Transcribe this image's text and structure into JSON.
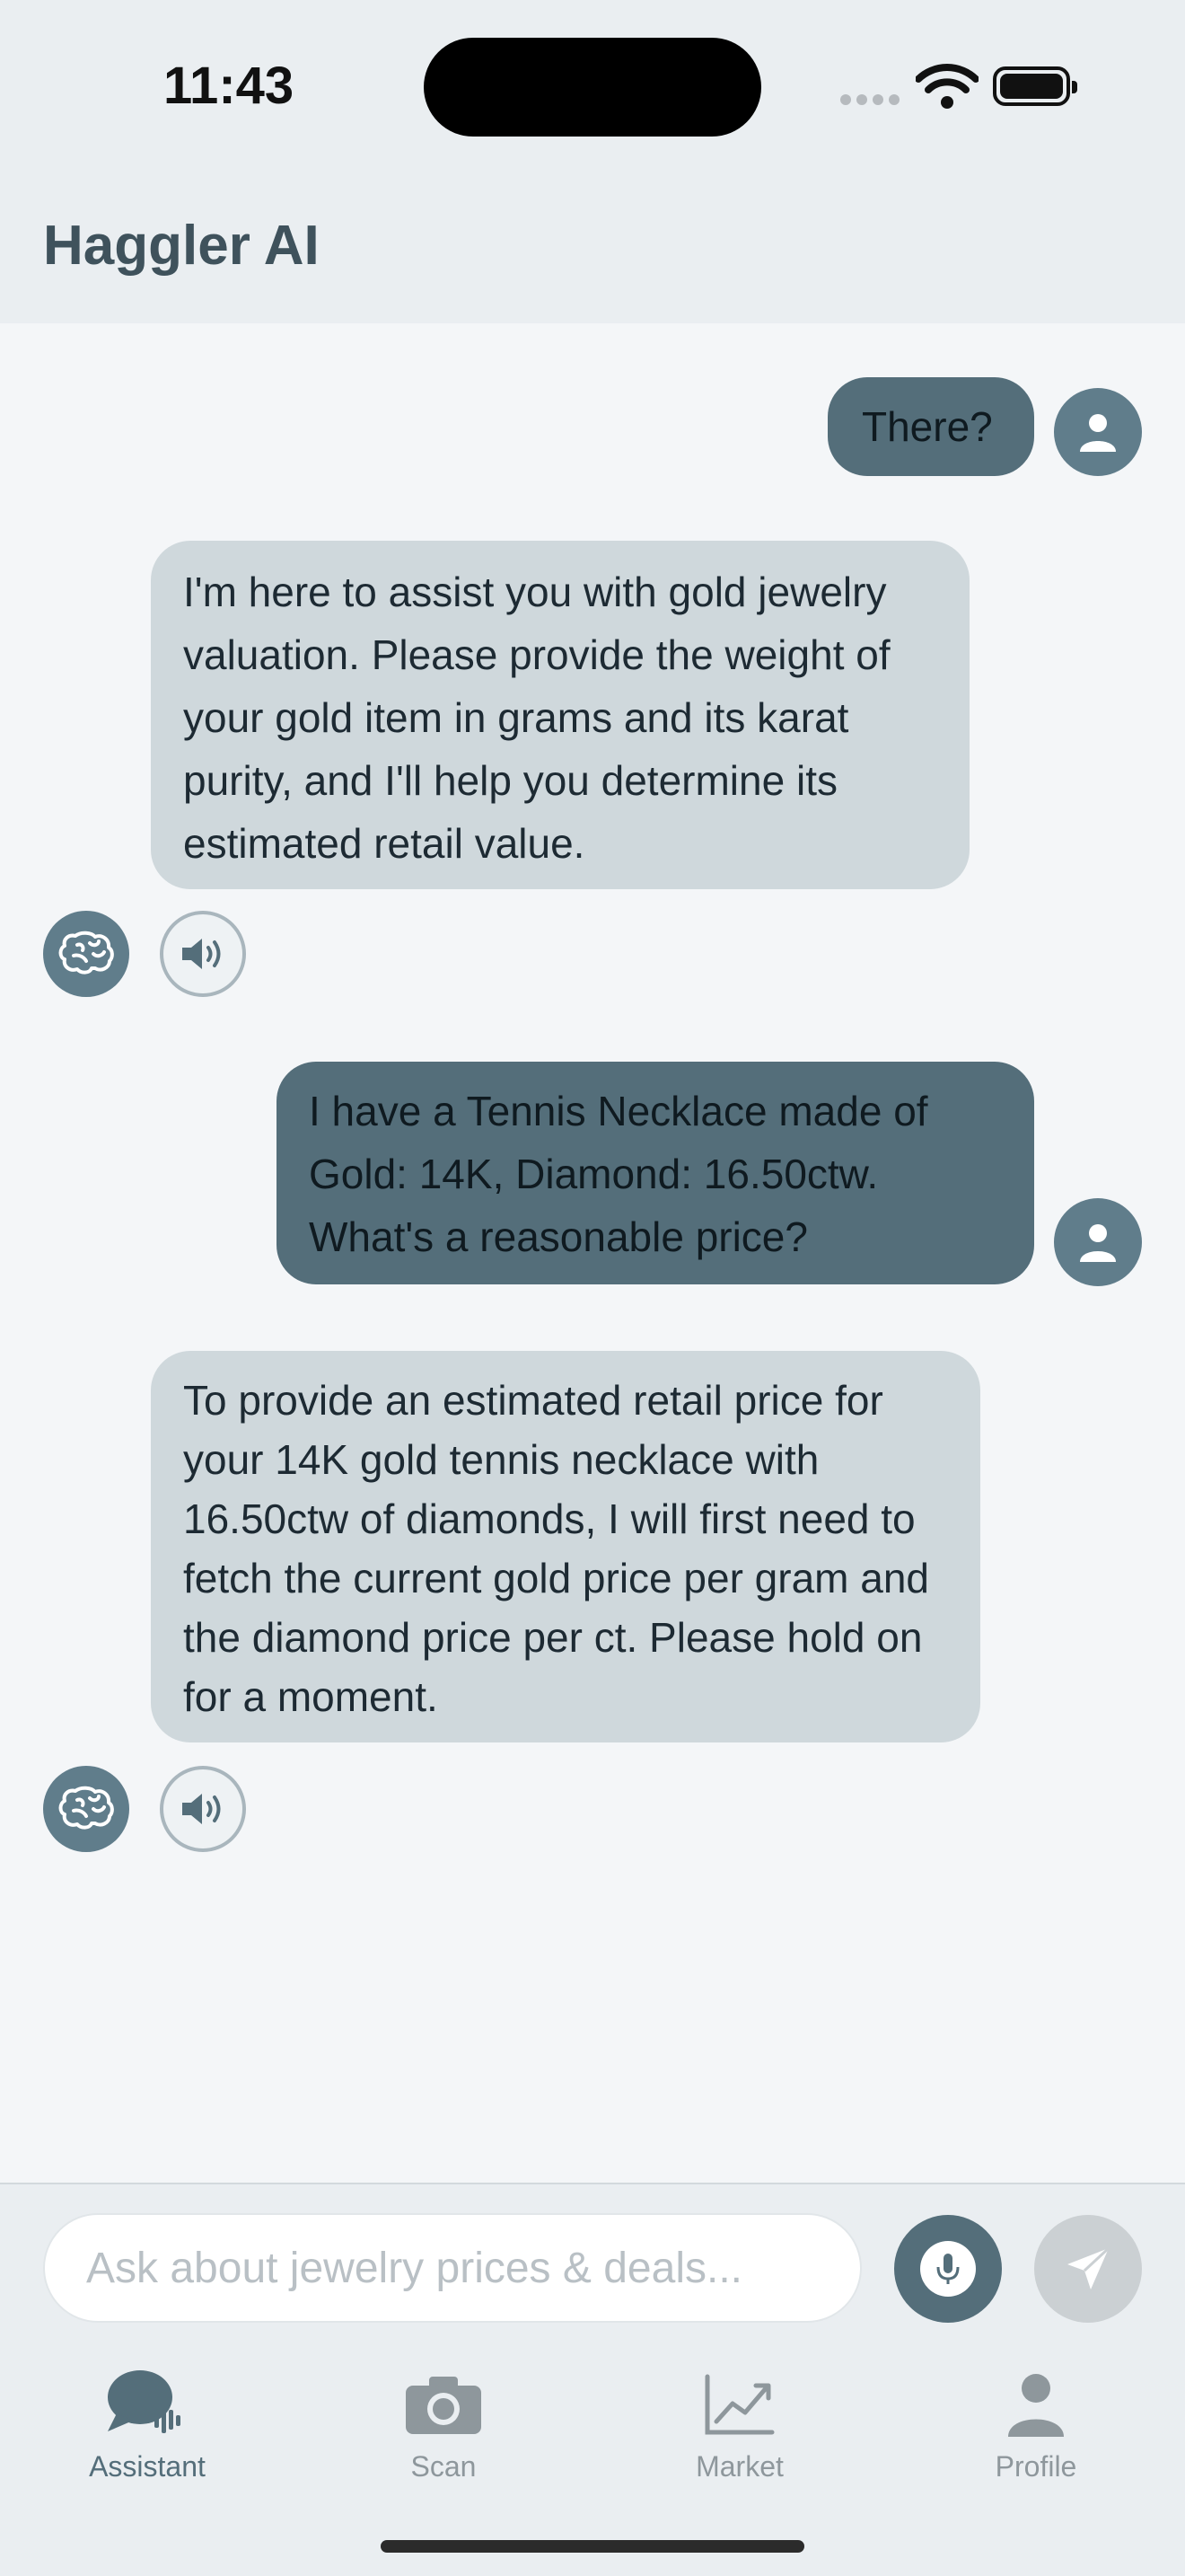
{
  "status_bar": {
    "time": "11:43"
  },
  "header": {
    "title": "Haggler AI"
  },
  "messages": [
    {
      "role": "user",
      "text": "There?"
    },
    {
      "role": "assistant",
      "text": "I'm here to assist you with gold jewelry valuation. Please provide the weight of your gold item in grams and its karat purity, and I'll help you determine its estimated retail value."
    },
    {
      "role": "user",
      "text": "I have a Tennis Necklace made of Gold: 14K, Diamond: 16.50ctw. What's a reasonable price?"
    },
    {
      "role": "assistant",
      "text": "To provide an estimated retail price for your 14K gold tennis necklace with 16.50ctw of diamonds, I will first need to fetch the current gold price per gram and the diamond price per ct. Please hold on for a moment."
    }
  ],
  "input": {
    "placeholder": "Ask about jewelry prices & deals...",
    "value": ""
  },
  "icons": {
    "user_avatar": "person-icon",
    "assistant": "brain-icon",
    "speak": "speaker-icon",
    "mic": "microphone-icon",
    "send": "send-icon"
  },
  "nav": {
    "active": "assistant",
    "items": [
      {
        "id": "assistant",
        "label": "Assistant",
        "icon": "chat-voice-icon"
      },
      {
        "id": "scan",
        "label": "Scan",
        "icon": "camera-icon"
      },
      {
        "id": "market",
        "label": "Market",
        "icon": "chart-icon"
      },
      {
        "id": "profile",
        "label": "Profile",
        "icon": "person-icon"
      }
    ]
  },
  "colors": {
    "user_bubble": "#546e7a",
    "assistant_bubble": "#cfd8dc",
    "accent": "#607d8b",
    "background": "#f4f6f8"
  }
}
